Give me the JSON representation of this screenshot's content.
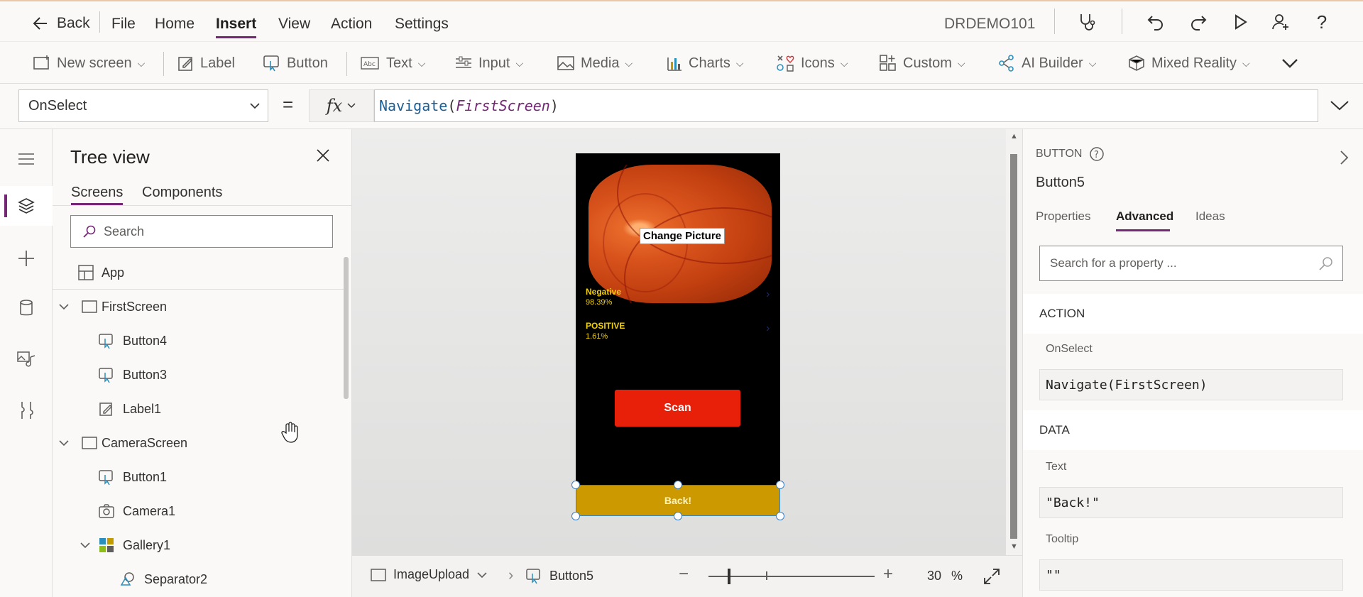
{
  "menubar": {
    "back": "Back",
    "items": [
      "File",
      "Home",
      "Insert",
      "View",
      "Action",
      "Settings"
    ],
    "active": "Insert",
    "env": "DRDEMO101"
  },
  "ribbon": {
    "new_screen": "New screen",
    "label": "Label",
    "button": "Button",
    "text": "Text",
    "input": "Input",
    "media": "Media",
    "charts": "Charts",
    "icons": "Icons",
    "custom": "Custom",
    "ai_builder": "AI Builder",
    "mixed_reality": "Mixed Reality"
  },
  "formula": {
    "property": "OnSelect",
    "equals": "=",
    "fx": "fx",
    "fn": "Navigate",
    "arg": "FirstScreen",
    "open": "(",
    "close": ")"
  },
  "tree": {
    "title": "Tree view",
    "tab_screens": "Screens",
    "tab_components": "Components",
    "search_placeholder": "Search",
    "nodes": {
      "app": "App",
      "first_screen": "FirstScreen",
      "button4": "Button4",
      "button3": "Button3",
      "label1": "Label1",
      "camera_screen": "CameraScreen",
      "button1": "Button1",
      "camera1": "Camera1",
      "gallery1": "Gallery1",
      "separator2": "Separator2"
    }
  },
  "phone": {
    "change_picture": "Change Picture",
    "negative_label": "Negative",
    "negative_value": "98.39%",
    "positive_label": "POSITIVE",
    "positive_value": "1.61%",
    "scan": "Scan",
    "back": "Back!",
    "colors": {
      "scan": "#e8200a",
      "back": "#cc9a00",
      "result_text": "#f3d100"
    }
  },
  "bottombar": {
    "screen": "ImageUpload",
    "control": "Button5",
    "zoom_value": "30",
    "zoom_unit": "%",
    "zoom_level": 0.3
  },
  "rpanel": {
    "type": "BUTTON",
    "name": "Button5",
    "tabs": [
      "Properties",
      "Advanced",
      "Ideas"
    ],
    "active_tab": "Advanced",
    "search_placeholder": "Search for a property ...",
    "action_header": "ACTION",
    "onselect_label": "OnSelect",
    "onselect_value": "Navigate(FirstScreen)",
    "data_header": "DATA",
    "text_label": "Text",
    "text_value": "\"Back!\"",
    "tooltip_label": "Tooltip",
    "tooltip_value": "\"\""
  },
  "accent": "#742774"
}
